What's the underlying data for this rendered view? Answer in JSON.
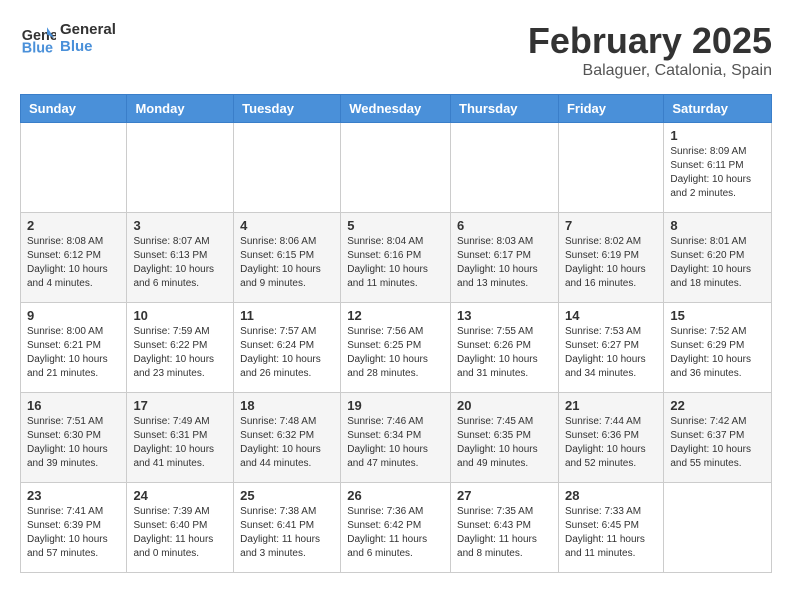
{
  "header": {
    "logo_line1": "General",
    "logo_line2": "Blue",
    "month_title": "February 2025",
    "location": "Balaguer, Catalonia, Spain"
  },
  "weekdays": [
    "Sunday",
    "Monday",
    "Tuesday",
    "Wednesday",
    "Thursday",
    "Friday",
    "Saturday"
  ],
  "weeks": [
    {
      "days": [
        {
          "num": "",
          "info": ""
        },
        {
          "num": "",
          "info": ""
        },
        {
          "num": "",
          "info": ""
        },
        {
          "num": "",
          "info": ""
        },
        {
          "num": "",
          "info": ""
        },
        {
          "num": "",
          "info": ""
        },
        {
          "num": "1",
          "info": "Sunrise: 8:09 AM\nSunset: 6:11 PM\nDaylight: 10 hours\nand 2 minutes."
        }
      ]
    },
    {
      "days": [
        {
          "num": "2",
          "info": "Sunrise: 8:08 AM\nSunset: 6:12 PM\nDaylight: 10 hours\nand 4 minutes."
        },
        {
          "num": "3",
          "info": "Sunrise: 8:07 AM\nSunset: 6:13 PM\nDaylight: 10 hours\nand 6 minutes."
        },
        {
          "num": "4",
          "info": "Sunrise: 8:06 AM\nSunset: 6:15 PM\nDaylight: 10 hours\nand 9 minutes."
        },
        {
          "num": "5",
          "info": "Sunrise: 8:04 AM\nSunset: 6:16 PM\nDaylight: 10 hours\nand 11 minutes."
        },
        {
          "num": "6",
          "info": "Sunrise: 8:03 AM\nSunset: 6:17 PM\nDaylight: 10 hours\nand 13 minutes."
        },
        {
          "num": "7",
          "info": "Sunrise: 8:02 AM\nSunset: 6:19 PM\nDaylight: 10 hours\nand 16 minutes."
        },
        {
          "num": "8",
          "info": "Sunrise: 8:01 AM\nSunset: 6:20 PM\nDaylight: 10 hours\nand 18 minutes."
        }
      ]
    },
    {
      "days": [
        {
          "num": "9",
          "info": "Sunrise: 8:00 AM\nSunset: 6:21 PM\nDaylight: 10 hours\nand 21 minutes."
        },
        {
          "num": "10",
          "info": "Sunrise: 7:59 AM\nSunset: 6:22 PM\nDaylight: 10 hours\nand 23 minutes."
        },
        {
          "num": "11",
          "info": "Sunrise: 7:57 AM\nSunset: 6:24 PM\nDaylight: 10 hours\nand 26 minutes."
        },
        {
          "num": "12",
          "info": "Sunrise: 7:56 AM\nSunset: 6:25 PM\nDaylight: 10 hours\nand 28 minutes."
        },
        {
          "num": "13",
          "info": "Sunrise: 7:55 AM\nSunset: 6:26 PM\nDaylight: 10 hours\nand 31 minutes."
        },
        {
          "num": "14",
          "info": "Sunrise: 7:53 AM\nSunset: 6:27 PM\nDaylight: 10 hours\nand 34 minutes."
        },
        {
          "num": "15",
          "info": "Sunrise: 7:52 AM\nSunset: 6:29 PM\nDaylight: 10 hours\nand 36 minutes."
        }
      ]
    },
    {
      "days": [
        {
          "num": "16",
          "info": "Sunrise: 7:51 AM\nSunset: 6:30 PM\nDaylight: 10 hours\nand 39 minutes."
        },
        {
          "num": "17",
          "info": "Sunrise: 7:49 AM\nSunset: 6:31 PM\nDaylight: 10 hours\nand 41 minutes."
        },
        {
          "num": "18",
          "info": "Sunrise: 7:48 AM\nSunset: 6:32 PM\nDaylight: 10 hours\nand 44 minutes."
        },
        {
          "num": "19",
          "info": "Sunrise: 7:46 AM\nSunset: 6:34 PM\nDaylight: 10 hours\nand 47 minutes."
        },
        {
          "num": "20",
          "info": "Sunrise: 7:45 AM\nSunset: 6:35 PM\nDaylight: 10 hours\nand 49 minutes."
        },
        {
          "num": "21",
          "info": "Sunrise: 7:44 AM\nSunset: 6:36 PM\nDaylight: 10 hours\nand 52 minutes."
        },
        {
          "num": "22",
          "info": "Sunrise: 7:42 AM\nSunset: 6:37 PM\nDaylight: 10 hours\nand 55 minutes."
        }
      ]
    },
    {
      "days": [
        {
          "num": "23",
          "info": "Sunrise: 7:41 AM\nSunset: 6:39 PM\nDaylight: 10 hours\nand 57 minutes."
        },
        {
          "num": "24",
          "info": "Sunrise: 7:39 AM\nSunset: 6:40 PM\nDaylight: 11 hours\nand 0 minutes."
        },
        {
          "num": "25",
          "info": "Sunrise: 7:38 AM\nSunset: 6:41 PM\nDaylight: 11 hours\nand 3 minutes."
        },
        {
          "num": "26",
          "info": "Sunrise: 7:36 AM\nSunset: 6:42 PM\nDaylight: 11 hours\nand 6 minutes."
        },
        {
          "num": "27",
          "info": "Sunrise: 7:35 AM\nSunset: 6:43 PM\nDaylight: 11 hours\nand 8 minutes."
        },
        {
          "num": "28",
          "info": "Sunrise: 7:33 AM\nSunset: 6:45 PM\nDaylight: 11 hours\nand 11 minutes."
        },
        {
          "num": "",
          "info": ""
        }
      ]
    }
  ]
}
